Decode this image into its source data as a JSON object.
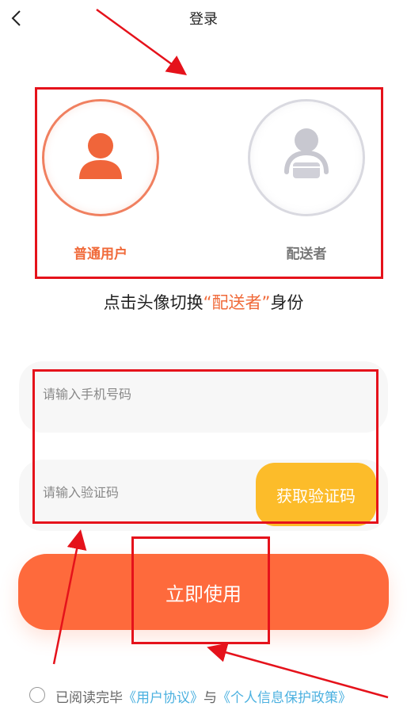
{
  "header": {
    "title": "登录",
    "back_icon": "chevron-left-icon"
  },
  "roles": {
    "user": {
      "label": "普通用户",
      "icon": "user-avatar-icon",
      "color": "#f06a3a"
    },
    "delivery": {
      "label": "配送者",
      "icon": "delivery-person-icon",
      "color": "#c8c8d0"
    }
  },
  "hint": {
    "prefix": "点击头像切换",
    "highlight": "“配送者”",
    "suffix": "身份"
  },
  "form": {
    "phone_placeholder": "请输入手机号码",
    "code_placeholder": "请输入验证码",
    "get_code_label": "获取验证码",
    "submit_label": "立即使用"
  },
  "agreement": {
    "prefix": "已阅读完毕",
    "user_agreement": "《用户协议》",
    "and": "与",
    "privacy_policy": "《个人信息保护政策》"
  },
  "colors": {
    "accent": "#fe6a3c",
    "code_button": "#fcbc2a",
    "link": "#4cb1e0",
    "annotation": "#e5121b"
  }
}
